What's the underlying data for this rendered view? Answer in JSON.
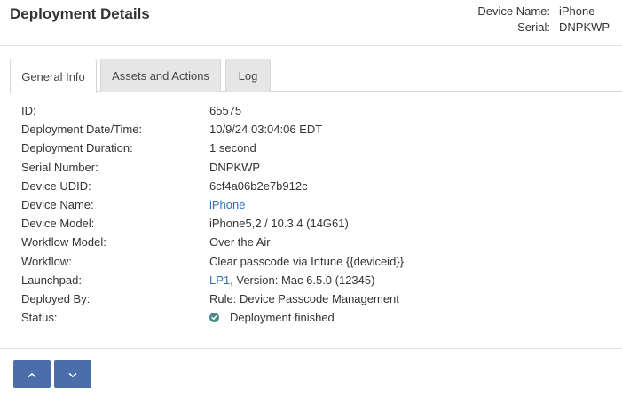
{
  "header": {
    "title": "Deployment Details",
    "device_name_label": "Device Name:",
    "device_name_value": "iPhone",
    "serial_label": "Serial:",
    "serial_value": "DNPKWP"
  },
  "tabs": [
    {
      "label": "General Info",
      "active": true
    },
    {
      "label": "Assets and Actions",
      "active": false
    },
    {
      "label": "Log",
      "active": false
    }
  ],
  "details": {
    "id_label": "ID:",
    "id_value": "65575",
    "date_label": "Deployment Date/Time:",
    "date_value": "10/9/24 03:04:06 EDT",
    "duration_label": "Deployment Duration:",
    "duration_value": "1 second",
    "serial_label": "Serial Number:",
    "serial_value": "DNPKWP",
    "udid_label": "Device UDID:",
    "udid_value": "6cf4a06b2e7b912c",
    "device_name_label": "Device Name:",
    "device_name_value": "iPhone",
    "model_label": "Device Model:",
    "model_value": "iPhone5,2 / 10.3.4 (14G61)",
    "workflow_model_label": "Workflow Model:",
    "workflow_model_value": "Over the Air",
    "workflow_label": "Workflow:",
    "workflow_value": "Clear passcode via Intune {{deviceid}}",
    "launchpad_label": "Launchpad:",
    "launchpad_link": "LP1",
    "launchpad_version": ", Version: Mac 6.5.0 (12345)",
    "deployed_by_label": "Deployed By:",
    "deployed_by_value": "Rule: Device Passcode Management",
    "status_label": "Status:",
    "status_value": "Deployment finished"
  },
  "icons": {
    "status": "check-circle-icon",
    "up": "chevron-up-icon",
    "down": "chevron-down-icon"
  },
  "colors": {
    "link": "#2f6fb5",
    "button": "#4a6ea9",
    "status_ok": "#4a8b87"
  }
}
